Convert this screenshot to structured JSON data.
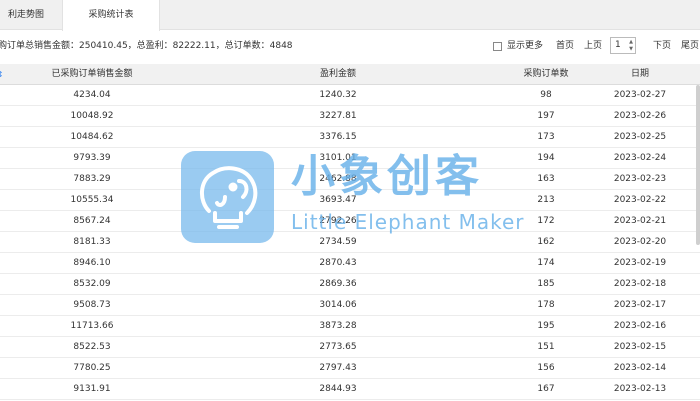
{
  "tabs": [
    {
      "label": "利走势图"
    },
    {
      "label": "采购统计表"
    }
  ],
  "summary": "购订单总销售金额：250410.45，总盈利：82222.11，总订单数：4848",
  "toolbar": {
    "show_more_label": "显示更多",
    "first_label": "首页",
    "prev_label": "上页",
    "page_value": "1",
    "next_label": "下页",
    "last_label": "尾页"
  },
  "table": {
    "columns": [
      "已采购订单销售金额",
      "盈利金额",
      "采购订单数",
      "日期"
    ],
    "rows": [
      [
        "4234.04",
        "1240.32",
        "98",
        "2023-02-27"
      ],
      [
        "10048.92",
        "3227.81",
        "197",
        "2023-02-26"
      ],
      [
        "10484.62",
        "3376.15",
        "173",
        "2023-02-25"
      ],
      [
        "9793.39",
        "3101.01",
        "194",
        "2023-02-24"
      ],
      [
        "7883.29",
        "2462.88",
        "163",
        "2023-02-23"
      ],
      [
        "10555.34",
        "3693.47",
        "213",
        "2023-02-22"
      ],
      [
        "8567.24",
        "2792.26",
        "172",
        "2023-02-21"
      ],
      [
        "8181.33",
        "2734.59",
        "162",
        "2023-02-20"
      ],
      [
        "8946.10",
        "2870.43",
        "174",
        "2023-02-19"
      ],
      [
        "8532.09",
        "2869.36",
        "185",
        "2023-02-18"
      ],
      [
        "9508.73",
        "3014.06",
        "178",
        "2023-02-17"
      ],
      [
        "11713.66",
        "3873.28",
        "195",
        "2023-02-16"
      ],
      [
        "8522.53",
        "2773.65",
        "151",
        "2023-02-15"
      ],
      [
        "7780.25",
        "2797.43",
        "156",
        "2023-02-14"
      ],
      [
        "9131.91",
        "2844.93",
        "167",
        "2023-02-13"
      ]
    ]
  },
  "watermark": {
    "title": "小象创客",
    "subtitle": "Little Elephant Maker",
    "color": "#64afe8"
  }
}
